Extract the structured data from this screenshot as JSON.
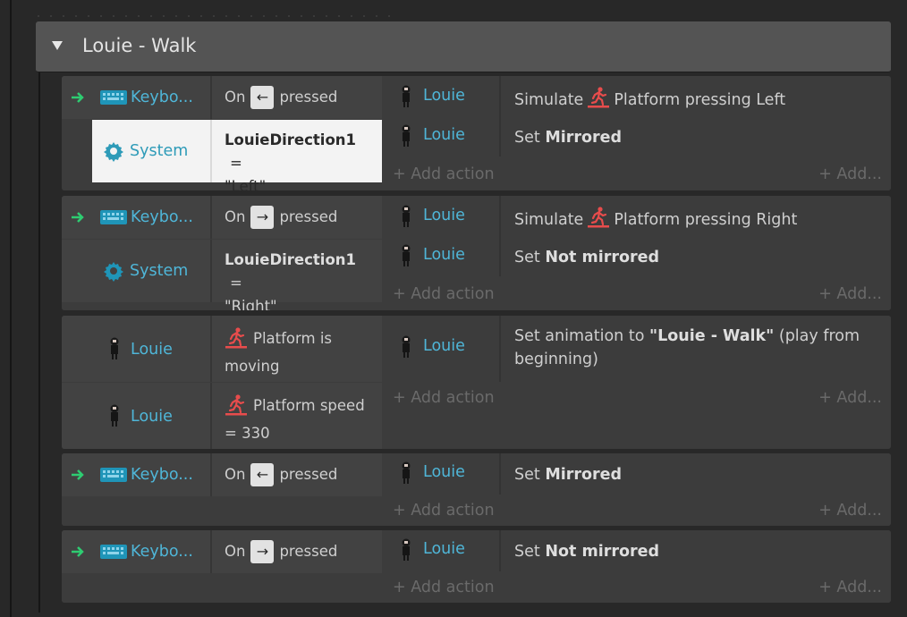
{
  "group": {
    "title": "Louie - Walk"
  },
  "labels": {
    "keyboard": "Keybo...",
    "system": "System",
    "louie": "Louie",
    "on": "On",
    "pressed": "pressed",
    "add_action": "Add action",
    "add_more": "Add...",
    "left_key": "←",
    "right_key": "→",
    "simulate": "Simulate",
    "platform_pressing_left": "Platform pressing Left",
    "platform_pressing_right": "Platform pressing Right",
    "set": "Set",
    "mirrored": "Mirrored",
    "not_mirrored": "Not mirrored",
    "louie_direction": "LouieDirection1",
    "eq": "=",
    "left_str": "\"Left\"",
    "right_str": "\"Right\"",
    "platform_is": "Platform is",
    "moving": "moving",
    "platform_speed": "Platform speed",
    "speed_val": "= 330",
    "set_anim_to": "Set animation to",
    "anim_name": "\"Louie - Walk\"",
    "play_from": "(play from",
    "beginning": "beginning)"
  },
  "colors": {
    "accent_link": "#4fb6d8",
    "trigger_arrow": "#2ecc71",
    "platform_icon": "#e84c4c",
    "selected_bg": "#f3f3f3"
  },
  "icons": {
    "keyboard": "keyboard-icon",
    "system": "gear-icon",
    "platform": "platform-runner-icon",
    "object": "louie-sprite-icon",
    "trigger": "trigger-arrow-icon",
    "collapse": "triangle-down-icon",
    "add": "plus-icon"
  }
}
